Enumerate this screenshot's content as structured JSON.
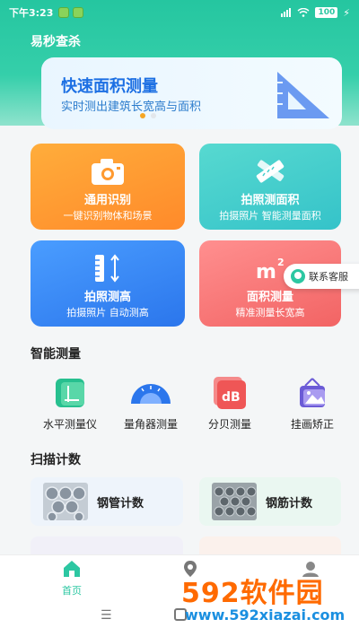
{
  "status_bar": {
    "time": "下午3:23",
    "battery": "100"
  },
  "app": {
    "title": "易秒查杀"
  },
  "banner": {
    "title": "快速面积测量",
    "subtitle": "实时测出建筑长宽高与面积",
    "active_index": 0,
    "dot_count": 2
  },
  "feature_cards": [
    {
      "title": "通用识别",
      "subtitle": "一键识别物体和场景",
      "icon": "camera-icon",
      "color": "#ff9a30"
    },
    {
      "title": "拍照测面积",
      "subtitle": "拍摄照片 智能测量面积",
      "icon": "ruler-pencil-icon",
      "color": "#45cdcc"
    },
    {
      "title": "拍照测高",
      "subtitle": "拍摄照片 自动测高",
      "icon": "height-ruler-icon",
      "color": "#3b88f5"
    },
    {
      "title": "面积测量",
      "subtitle": "精准测量长宽高",
      "icon": "square-meter-icon",
      "color": "#f67676"
    }
  ],
  "contact": {
    "label": "联系客服"
  },
  "sections": {
    "smart_measure": "智能测量",
    "scan_count": "扫描计数"
  },
  "tools": [
    {
      "label": "水平测量仪",
      "icon": "level-icon"
    },
    {
      "label": "量角器测量",
      "icon": "protractor-icon"
    },
    {
      "label": "分贝测量",
      "icon": "decibel-icon"
    },
    {
      "label": "挂画矫正",
      "icon": "picture-frame-icon"
    }
  ],
  "scan_items": [
    {
      "label": "钢管计数",
      "icon": "steel-pipes-image"
    },
    {
      "label": "钢筋计数",
      "icon": "rebar-image"
    }
  ],
  "tabs": [
    {
      "label": "首页",
      "icon": "home-icon",
      "active": true
    }
  ],
  "watermark": {
    "big": "592软件园",
    "small": "www.592xiazai.com"
  },
  "colors": {
    "accent": "#2cc7a2",
    "banner_title": "#1c6fe3"
  }
}
